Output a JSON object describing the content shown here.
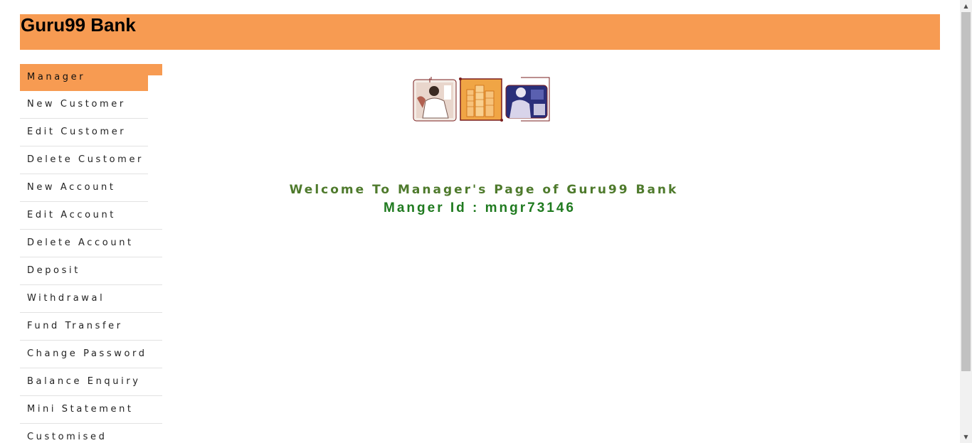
{
  "header": {
    "title": "Guru99 Bank",
    "bg_color": "#f79b52"
  },
  "menu": {
    "items": [
      {
        "label": "Manager",
        "active": true
      },
      {
        "label": "New Customer"
      },
      {
        "label": "Edit Customer"
      },
      {
        "label": "Delete Customer"
      },
      {
        "label": "New Account"
      },
      {
        "label": "Edit Account"
      },
      {
        "label": "Delete Account"
      },
      {
        "label": "Deposit"
      },
      {
        "label": "Withdrawal"
      },
      {
        "label": "Fund Transfer"
      },
      {
        "label": "Change Password"
      },
      {
        "label": "Balance Enquiry"
      },
      {
        "label": "Mini Statement"
      },
      {
        "label": "Customised"
      }
    ]
  },
  "main": {
    "welcome_text": "Welcome To Manager's Page of Guru99 Bank",
    "manager_id_text": "Manger Id : mngr73146",
    "welcome_color": "#4e7a2c",
    "manager_id_color": "#1f7a1f"
  },
  "banner": {
    "icons": [
      "banker-phone-photo",
      "coin-stacks-photo",
      "customer-service-photo"
    ]
  },
  "scrollbar": {
    "up_icon": "scroll-up-arrow-icon",
    "down_icon": "scroll-down-arrow-icon"
  }
}
